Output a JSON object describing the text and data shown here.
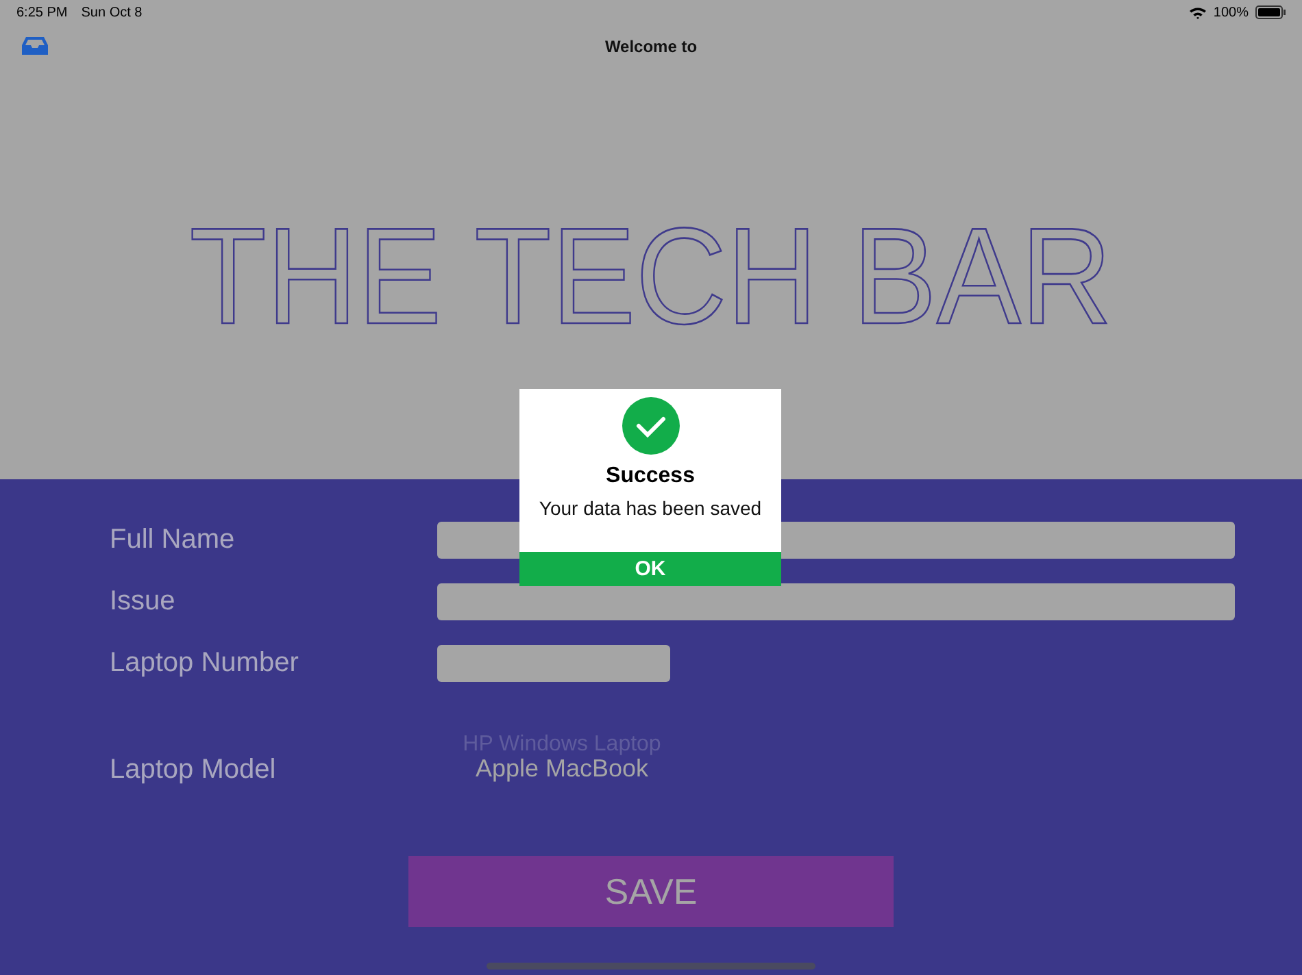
{
  "status_bar": {
    "time": "6:25 PM",
    "date": "Sun Oct 8",
    "battery": "100%"
  },
  "nav": {
    "title": "Welcome to"
  },
  "hero": {
    "title": "THE TECH BAR"
  },
  "form": {
    "fields": [
      {
        "label": "Full Name",
        "kind": "wide"
      },
      {
        "label": "Issue",
        "kind": "wide"
      },
      {
        "label": "Laptop Number",
        "kind": "short"
      }
    ],
    "picker": {
      "label": "Laptop Model",
      "options": [
        {
          "label": "HP Windows Laptop",
          "selected": false
        },
        {
          "label": "Apple MacBook",
          "selected": true
        }
      ]
    },
    "save_button": "SAVE"
  },
  "dialog": {
    "title": "Success",
    "message": "Your data has been saved",
    "button": "OK"
  }
}
